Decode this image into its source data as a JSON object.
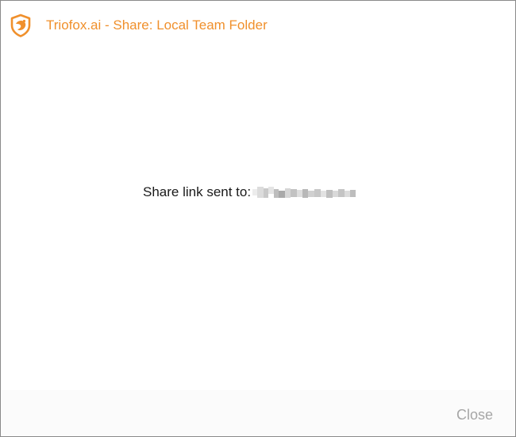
{
  "window": {
    "title": "Triofox.ai - Share: Local Team Folder",
    "icon": "triofox-shield-icon"
  },
  "message": {
    "label": "Share link sent to:",
    "recipient_state": "redacted"
  },
  "footer": {
    "close_label": "Close"
  },
  "colors": {
    "accent": "#f0902c",
    "text": "#1a1a1a",
    "muted": "#a6a6a6",
    "footer_bg": "#fbfbfb"
  }
}
